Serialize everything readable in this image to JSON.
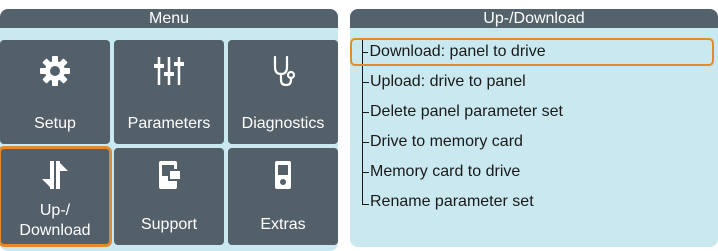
{
  "menu": {
    "title": "Menu",
    "tiles": [
      {
        "label": "Setup",
        "icon": "gear-icon"
      },
      {
        "label": "Parameters",
        "icon": "sliders-icon"
      },
      {
        "label": "Diagnostics",
        "icon": "stethoscope-icon"
      },
      {
        "label": "Up-/\nDownload",
        "icon": "transfer-arrows-icon",
        "selected": true
      },
      {
        "label": "Support",
        "icon": "support-device-icon"
      },
      {
        "label": "Extras",
        "icon": "memory-card-icon"
      }
    ]
  },
  "updownload": {
    "title": "Up-/Download",
    "items": [
      {
        "label": "Download: panel to drive",
        "selected": true
      },
      {
        "label": "Upload: drive to panel"
      },
      {
        "label": "Delete panel parameter set"
      },
      {
        "label": "Drive to memory card"
      },
      {
        "label": "Memory card to drive"
      },
      {
        "label": "Rename parameter set"
      }
    ]
  },
  "colors": {
    "accent": "#e58a2b",
    "tile": "#546069",
    "panel_bg": "#c9e8ef",
    "header": "#54626c"
  }
}
